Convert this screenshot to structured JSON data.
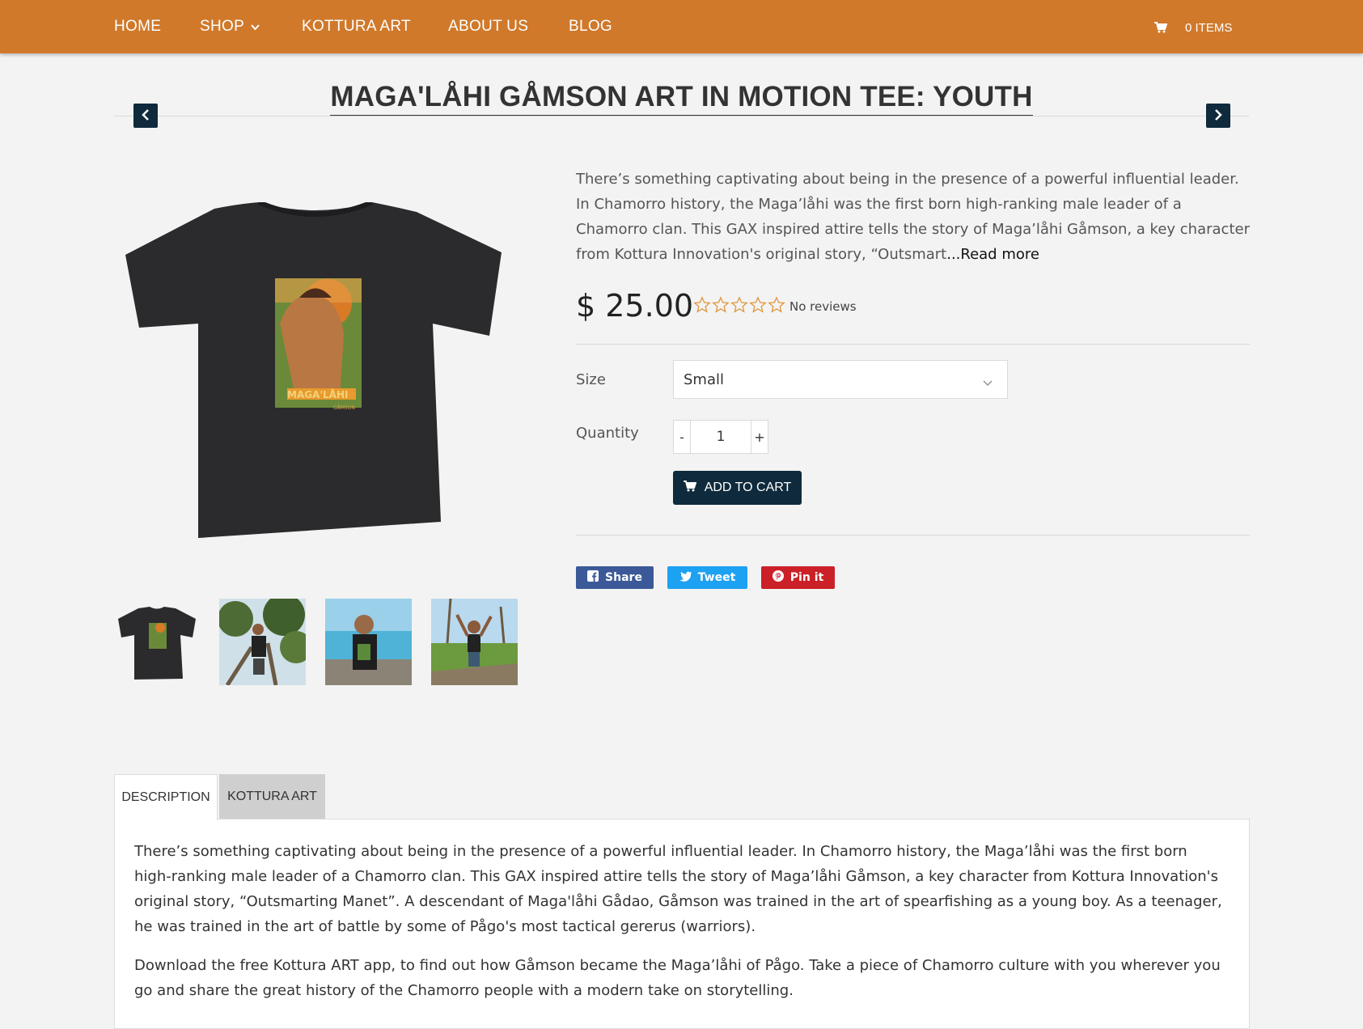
{
  "nav": {
    "items": [
      {
        "label": "HOME"
      },
      {
        "label": "SHOP",
        "has_dropdown": true
      },
      {
        "label": "KOTTURA ART"
      },
      {
        "label": "ABOUT US"
      },
      {
        "label": "BLOG"
      }
    ],
    "cart_label": "0 ITEMS",
    "background": "#d0792b"
  },
  "product": {
    "title": "MAGA'LÅHI GÅMSON ART IN MOTION TEE: YOUTH",
    "short_description": "There’s something captivating about being in the presence of a powerful influential leader. In Chamorro history, the Maga’låhi was the first born high-ranking male leader of a Chamorro clan. This GAX inspired attire tells the story of Maga’låhi Gåmson, a key character from Kottura Innovation's original story, “Outsmart",
    "read_more": "...Read more",
    "price": "$ 25.00",
    "rating_stars": 0,
    "rating_max": 5,
    "reviews_text": "No reviews",
    "size_label": "Size",
    "size_value": "Small",
    "quantity_label": "Quantity",
    "quantity_minus": "-",
    "quantity_value": "1",
    "quantity_plus": "+",
    "add_to_cart": "ADD TO CART",
    "shirt_print_text": "MAGA'LÅHI",
    "shirt_print_sub": "GÅMSON"
  },
  "share": {
    "facebook": "Share",
    "twitter": "Tweet",
    "pinterest": "Pin it"
  },
  "tabs": [
    {
      "label": "DESCRIPTION",
      "active": true
    },
    {
      "label": "KOTTURA ART",
      "active": false
    }
  ],
  "description": {
    "paragraph1": "There’s something captivating about being in the presence of a powerful influential leader. In Chamorro history, the Maga’låhi was the first born high-ranking male leader of a Chamorro clan. This GAX inspired attire tells the story of Maga’låhi Gåmson, a key character from Kottura Innovation's original story, “Outsmarting Manet”. A descendant of Maga'låhi Gådao, Gåmson was trained in the art of spearfishing as a young boy. As a teenager, he was trained in the art of battle by some of Pågo's most tactical gererus (warriors).",
    "paragraph2": "Download the free Kottura ART app, to find out how Gåmson became the Maga’låhi of Pågo. Take a piece of Chamorro culture with you wherever you go and share the great history of the Chamorro people with a modern take on storytelling."
  },
  "colors": {
    "accent": "#d0792b",
    "button_dark": "#0f2a3c",
    "facebook": "#3b5998",
    "twitter": "#1da1f2",
    "pinterest": "#cb2027"
  }
}
